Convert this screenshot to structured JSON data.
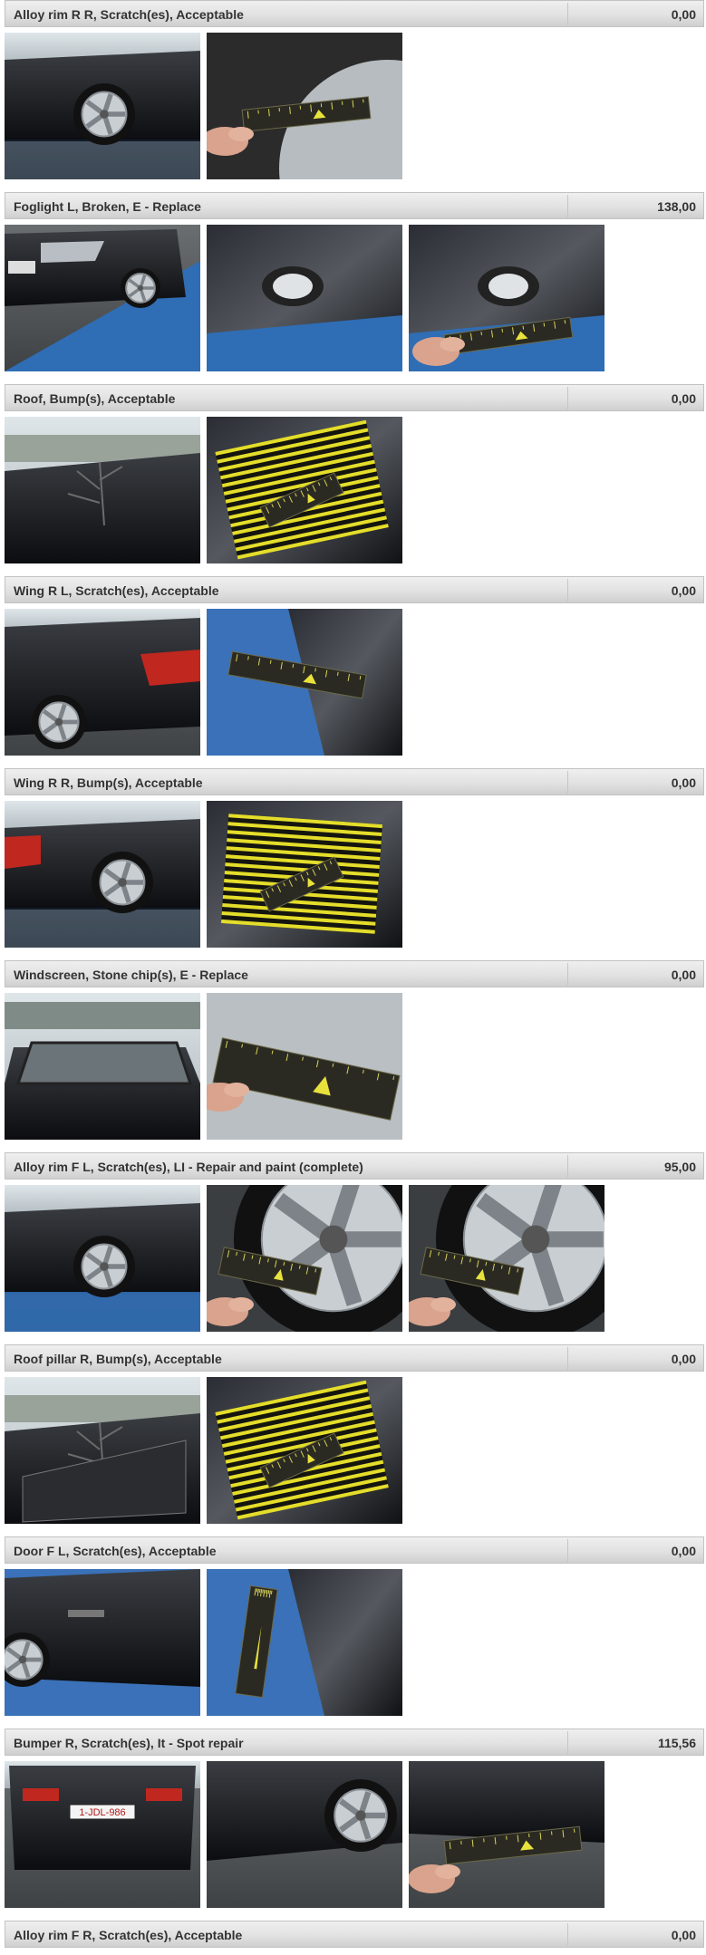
{
  "rows": [
    {
      "label": "Alloy rim R R, Scratch(es), Acceptable",
      "amount": "0,00",
      "photos": [
        "car-side-wheel",
        "ruler-on-tire"
      ]
    },
    {
      "label": "Foglight L, Broken, E - Replace",
      "amount": "138,00",
      "photos": [
        "car-front-bumper",
        "foglight-closeup",
        "foglight-with-ruler"
      ]
    },
    {
      "label": "Roof, Bump(s), Acceptable",
      "amount": "0,00",
      "photos": [
        "roof-reflection",
        "roof-with-stripe-board"
      ]
    },
    {
      "label": "Wing R L, Scratch(es), Acceptable",
      "amount": "0,00",
      "photos": [
        "car-rear-left",
        "ruler-on-wing"
      ]
    },
    {
      "label": "Wing R R, Bump(s), Acceptable",
      "amount": "0,00",
      "photos": [
        "car-rear-right",
        "wing-with-stripe-board"
      ]
    },
    {
      "label": "Windscreen, Stone chip(s), E - Replace",
      "amount": "0,00",
      "photos": [
        "car-windscreen",
        "windscreen-ruler"
      ]
    },
    {
      "label": "Alloy rim F L, Scratch(es), LI - Repair and paint (complete)",
      "amount": "95,00",
      "photos": [
        "car-front-wheel",
        "rim-with-ruler",
        "rim-valve-ruler"
      ]
    },
    {
      "label": "Roof pillar R, Bump(s), Acceptable",
      "amount": "0,00",
      "photos": [
        "car-roof-pillar",
        "pillar-with-stripe-board"
      ]
    },
    {
      "label": "Door F L, Scratch(es), Acceptable",
      "amount": "0,00",
      "photos": [
        "car-door-left",
        "door-with-ruler"
      ]
    },
    {
      "label": "Bumper R, Scratch(es), It - Spot repair",
      "amount": "115,56",
      "plate": "1-JDL-986",
      "photos": [
        "car-rear-plate",
        "rear-bumper-corner",
        "bumper-with-ruler"
      ]
    },
    {
      "label": "Alloy rim F R, Scratch(es), Acceptable",
      "amount": "0,00",
      "photos": []
    }
  ]
}
